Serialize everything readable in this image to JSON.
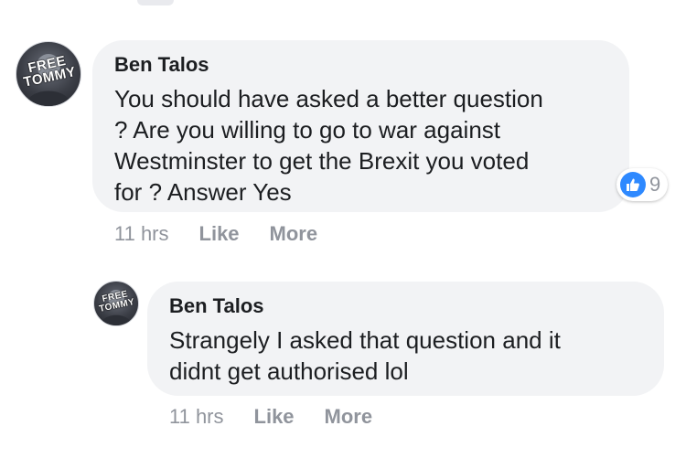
{
  "comments": [
    {
      "author": "Ben Talos",
      "avatar_band": "FREE\nTOMMY",
      "text": "You should have asked a better question\n? Are you willing to go to war against\nWestminster to get the Brexit you voted\nfor ? Answer Yes",
      "time": "11 hrs",
      "like_label": "Like",
      "more_label": "More",
      "reaction": {
        "icon": "thumbs-up-icon",
        "count": "9",
        "color": "#2e89ff"
      }
    },
    {
      "author": "Ben Talos",
      "avatar_band": "FREE\nTOMMY",
      "text": "Strangely I asked that question and it\ndidnt get authorised lol",
      "time": "11 hrs",
      "like_label": "Like",
      "more_label": "More"
    }
  ],
  "colors": {
    "bubble": "#f2f3f5",
    "meta_text": "#90949c",
    "body_text": "#1c1e21",
    "like_blue": "#2e89ff"
  }
}
